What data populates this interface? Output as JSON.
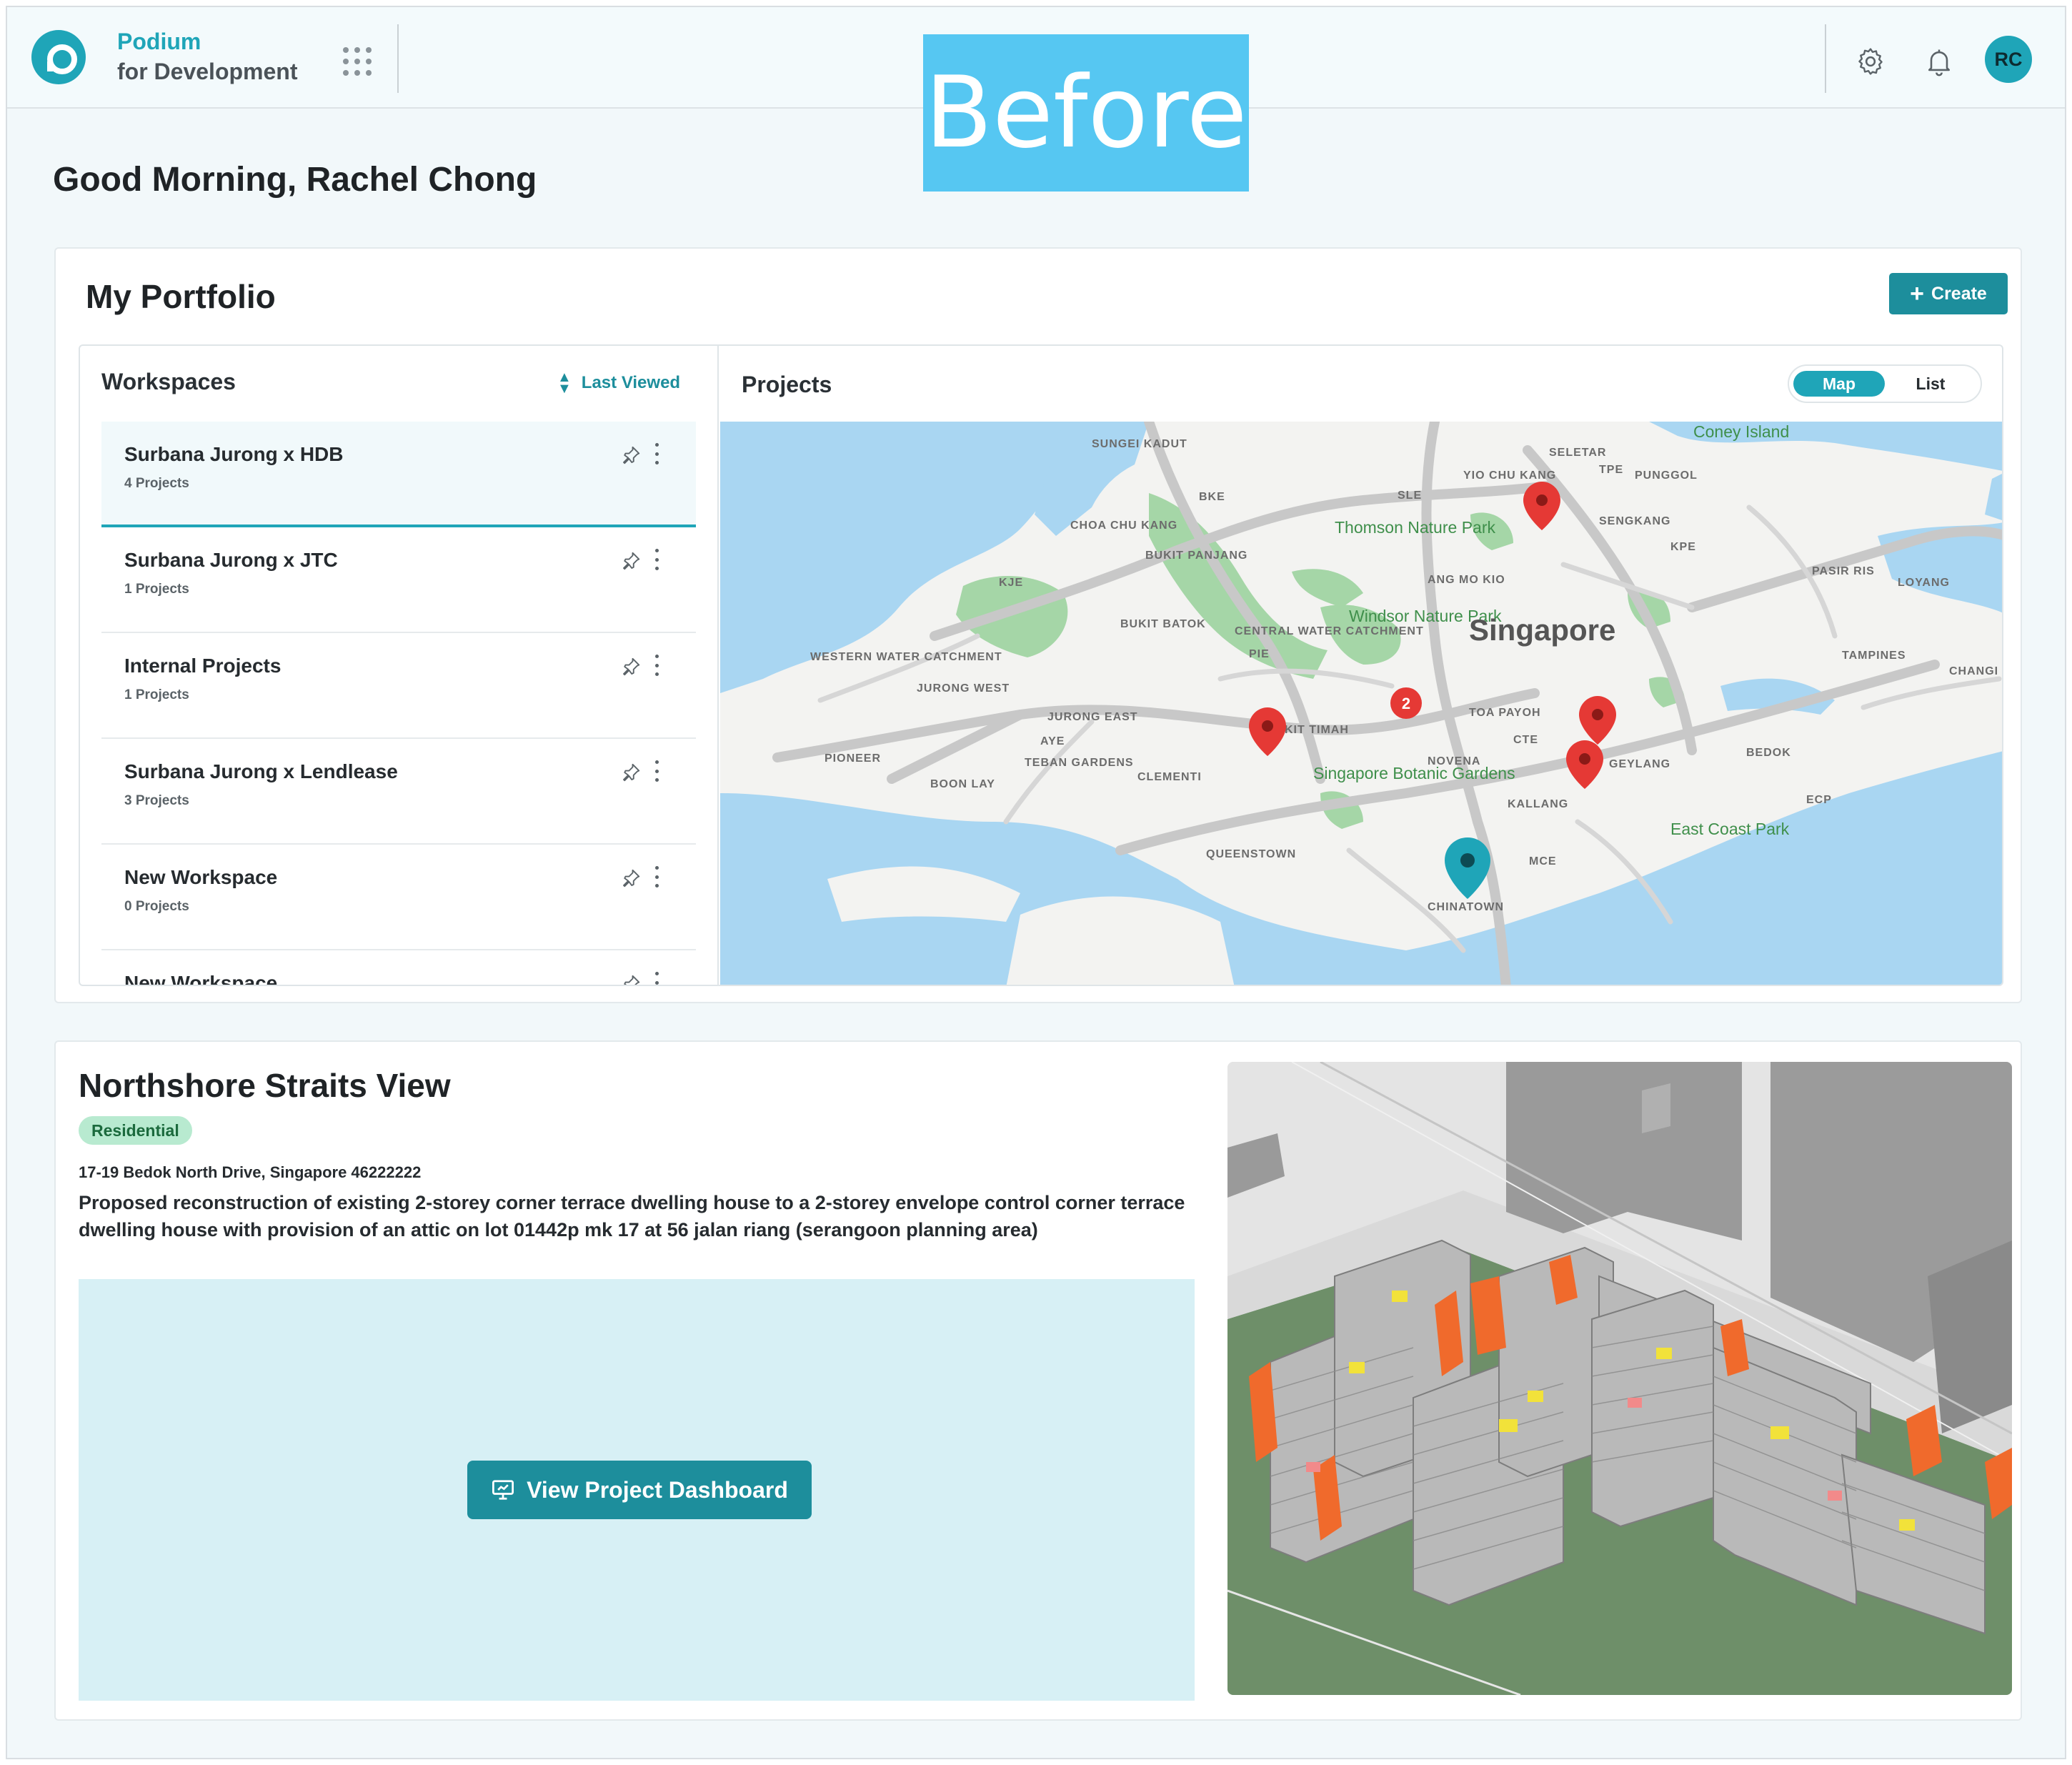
{
  "app": {
    "brand_line1": "Podium",
    "brand_line2": "for Development",
    "overlay_label": "Before",
    "user_initials": "RC",
    "accent_color": "#1fa5b8"
  },
  "greeting": "Good Morning, Rachel Chong",
  "portfolio": {
    "title": "My Portfolio",
    "create_label": "Create",
    "workspaces_title": "Workspaces",
    "sort_label": "Last Viewed",
    "workspaces": [
      {
        "name": "Surbana Jurong x HDB",
        "count": "4 Projects"
      },
      {
        "name": "Surbana Jurong x JTC",
        "count": "1 Projects"
      },
      {
        "name": "Internal Projects",
        "count": "1 Projects"
      },
      {
        "name": "Surbana Jurong x Lendlease",
        "count": "3 Projects"
      },
      {
        "name": "New Workspace",
        "count": "0 Projects"
      },
      {
        "name": "New Workspace",
        "count": ""
      }
    ],
    "projects_title": "Projects",
    "view_toggle": {
      "map": "Map",
      "list": "List",
      "selected": "Map"
    }
  },
  "map": {
    "labels": {
      "singapore": "Singapore",
      "sungei_kadut": "SUNGEI KADUT",
      "seletar": "SELETAR",
      "coney_island": "Coney Island",
      "yio_chu_kang": "YIO CHU KANG",
      "punggol": "PUNGGOL",
      "sle": "SLE",
      "tpe": "TPE",
      "choa_chu_kang": "CHOA CHU KANG",
      "bukit_panjang": "BUKIT PANJANG",
      "thomson": "Thomson Nature Park",
      "sengkang": "SENGKANG",
      "kje": "KJE",
      "ang_mo_kio": "ANG MO KIO",
      "pasir_ris": "PASIR RIS",
      "loyang": "LOYANG",
      "bukit_batok": "BUKIT BATOK",
      "central_water": "CENTRAL WATER CATCHMENT",
      "windsor": "Windsor Nature Park",
      "tampines": "TAMPINES",
      "changi": "CHANGI",
      "western_water": "WESTERN WATER CATCHMENT",
      "jurong_west": "JURONG WEST",
      "pie": "PIE",
      "jurong_east": "JURONG EAST",
      "toa_payoh": "TOA PAYOH",
      "bukit_timah": "KIT TIMAH",
      "ayeh": "AYE",
      "pioneer": "PIONEER",
      "teban_gardens": "TEBAN GARDENS",
      "clementi": "CLEMENTI",
      "novena": "NOVENA",
      "botanic": "Singapore Botanic Gardens",
      "geylang": "GEYLANG",
      "bedok": "BEDOK",
      "boon_lay": "BOON LAY",
      "kallang": "KALLANG",
      "ecp": "ECP",
      "east_coast": "East Coast Park",
      "queenstown": "QUEENSTOWN",
      "chinatown": "CHINATOWN",
      "mce": "MCE",
      "bke": "BKE",
      "cte": "CTE",
      "kpe": "KPE"
    },
    "cluster_count": "2",
    "marker_color": "#e53935",
    "selected_marker_color": "#1fa5b8"
  },
  "project": {
    "name": "Northshore Straits View",
    "tag": "Residential",
    "address": "17-19 Bedok North Drive, Singapore 46222222",
    "description": "Proposed reconstruction of existing 2-storey corner terrace dwelling house to a 2-storey envelope control corner terrace dwelling house with provision of an attic on lot 01442p mk 17 at 56 jalan riang (serangoon planning area)",
    "dashboard_label": "View Project Dashboard"
  }
}
